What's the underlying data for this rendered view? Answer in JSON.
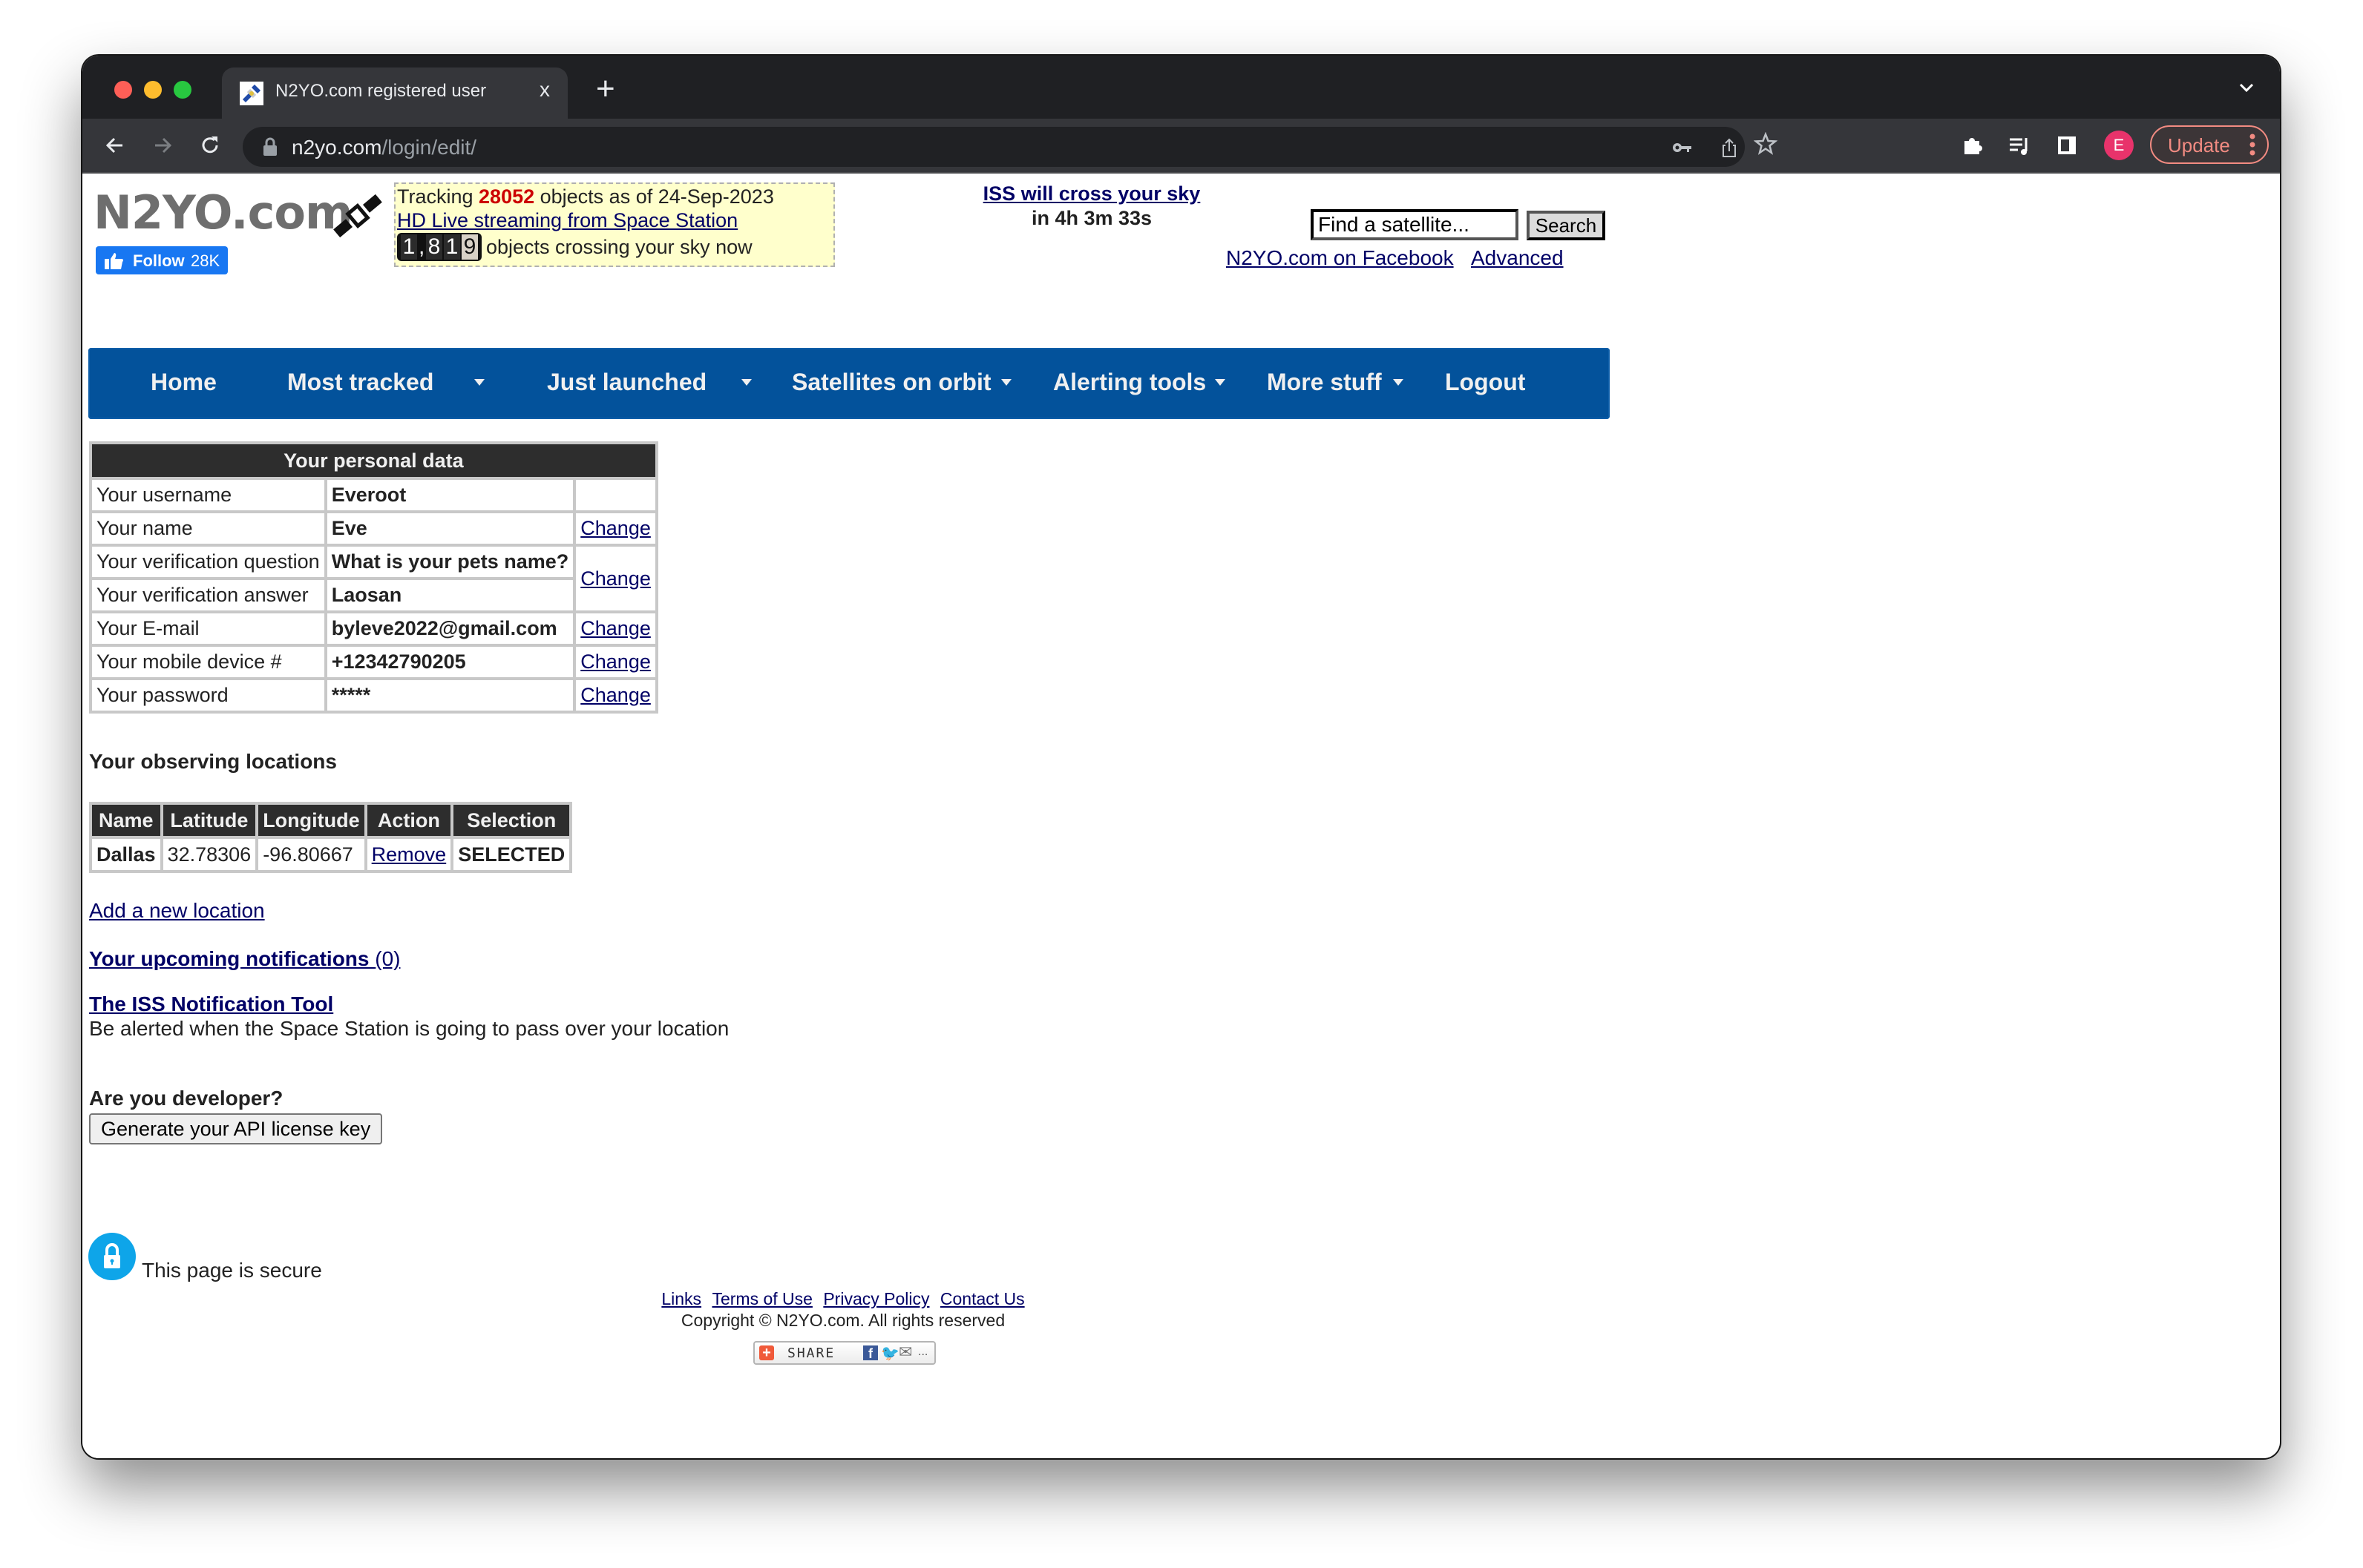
{
  "browser": {
    "tab_title": "N2YO.com registered user",
    "tab_close": "x",
    "new_tab": "+",
    "url_host": "n2yo.com",
    "url_path": "/login/edit/",
    "profile_initial": "E",
    "update_label": "Update",
    "colors": {
      "frame": "#1f2023",
      "toolbar": "#35363a",
      "update": "#f28b82",
      "avatar": "#e8336b"
    }
  },
  "header": {
    "logo": "N2YO.com",
    "fb_follow_label": "Follow",
    "fb_follow_count": "28K",
    "tracking_prefix": "Tracking ",
    "tracking_count": "28052",
    "tracking_suffix": " objects as of 24-Sep-2023",
    "hd_stream_link": "HD Live streaming from Space Station",
    "crossing_digits": [
      "1",
      ",",
      "8",
      "1",
      "9"
    ],
    "crossing_text": "objects crossing your sky now",
    "iss_link": "ISS will cross your sky",
    "iss_time": "in 4h 3m 33s",
    "search_placeholder": "Find a satellite...",
    "search_button": "Search",
    "facebook_link": "N2YO.com on Facebook",
    "advanced_link": "Advanced"
  },
  "nav": {
    "items": [
      {
        "label": "Home",
        "dropdown": false
      },
      {
        "label": "Most tracked",
        "dropdown": true
      },
      {
        "label": "Just launched",
        "dropdown": true
      },
      {
        "label": "Satellites on orbit",
        "dropdown": true
      },
      {
        "label": "Alerting tools",
        "dropdown": true
      },
      {
        "label": "More stuff",
        "dropdown": true
      },
      {
        "label": "Logout",
        "dropdown": false
      }
    ],
    "color": "#03529b"
  },
  "personal": {
    "title": "Your personal data",
    "rows": [
      {
        "label": "Your username",
        "value": "Everoot",
        "action": ""
      },
      {
        "label": "Your name",
        "value": "Eve",
        "action": "Change"
      },
      {
        "label": "Your verification question",
        "value": "What is your pets name?",
        "action": "Change"
      },
      {
        "label": "Your verification answer",
        "value": "Laosan",
        "action": ""
      },
      {
        "label": "Your E-mail",
        "value": "byleve2022@gmail.com",
        "action": "Change"
      },
      {
        "label": "Your mobile device #",
        "value": "+12342790205",
        "action": "Change"
      },
      {
        "label": "Your password",
        "value": "*****",
        "action": "Change"
      }
    ]
  },
  "locations": {
    "title": "Your observing locations",
    "headers": [
      "Name",
      "Latitude",
      "Longitude",
      "Action",
      "Selection"
    ],
    "rows": [
      {
        "name": "Dallas",
        "latitude": "32.78306",
        "longitude": "-96.80667",
        "action": "Remove",
        "selection": "SELECTED"
      }
    ],
    "add_link": "Add a new location"
  },
  "notifications": {
    "link": "Your upcoming notifications ",
    "count": "(0)",
    "iss_tool_link": "The ISS Notification Tool",
    "iss_tool_desc": "Be alerted when the Space Station is going to pass over your location"
  },
  "developer": {
    "question": "Are you developer?",
    "button": "Generate your API license key"
  },
  "security": {
    "text": "This page is secure"
  },
  "footer": {
    "links": [
      "Links",
      "Terms of Use",
      "Privacy Policy",
      "Contact Us"
    ],
    "copyright": "Copyright © N2YO.com. All rights reserved",
    "share_label": "SHARE"
  }
}
